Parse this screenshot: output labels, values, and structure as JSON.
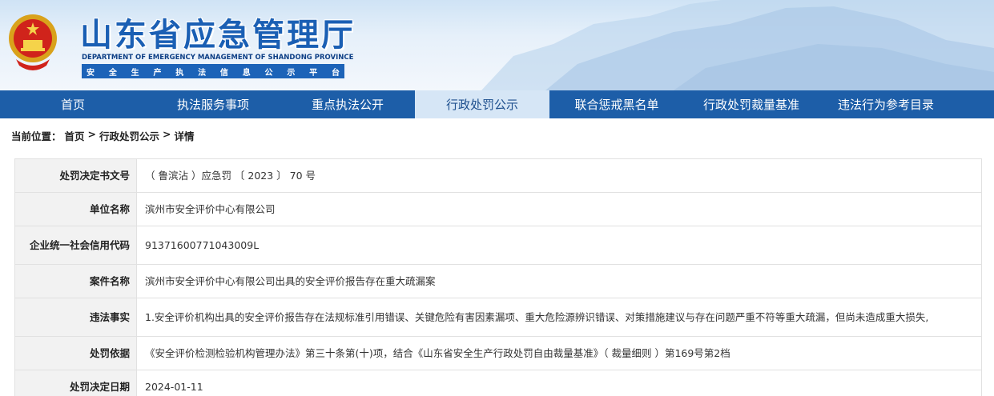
{
  "header": {
    "title": "山东省应急管理厅",
    "subtitle_en": "DEPARTMENT OF EMERGENCY MANAGEMENT OF SHANDONG PROVINCE",
    "subtitle_cn_chars": [
      "安",
      "全",
      "生",
      "产",
      "执",
      "法",
      "信",
      "息",
      "公",
      "示",
      "平",
      "台"
    ]
  },
  "nav": {
    "items": [
      {
        "label": "首页"
      },
      {
        "label": "执法服务事项"
      },
      {
        "label": "重点执法公开"
      },
      {
        "label": "行政处罚公示"
      },
      {
        "label": "联合惩戒黑名单"
      },
      {
        "label": "行政处罚裁量基准"
      },
      {
        "label": "违法行为参考目录"
      }
    ],
    "active_index": 3
  },
  "breadcrumb": {
    "prefix": "当前位置：",
    "home": "首页",
    "sep1": ">",
    "section": "行政处罚公示",
    "sep2": ">",
    "current": "详情"
  },
  "detail": {
    "rows": [
      {
        "label": "处罚决定书文号",
        "value": "（ 鲁滨沾 ）应急罚 〔 2023 〕 70 号"
      },
      {
        "label": "单位名称",
        "value": "滨州市安全评价中心有限公司"
      },
      {
        "label": "企业统一社会信用代码",
        "value": "91371600771043009L"
      },
      {
        "label": "案件名称",
        "value": "滨州市安全评价中心有限公司出具的安全评价报告存在重大疏漏案"
      },
      {
        "label": "违法事实",
        "value": "1.安全评价机构出具的安全评价报告存在法规标准引用错误、关键危险有害因素漏项、重大危险源辨识错误、对策措施建议与存在问题严重不符等重大疏漏，但尚未造成重大损失,"
      },
      {
        "label": "处罚依据",
        "value": "《安全评价检测检验机构管理办法》第三十条第(十)项，结合《山东省安全生产行政处罚自由裁量基准》（ 裁量细则 ）第169号第2档"
      },
      {
        "label": "处罚决定日期",
        "value": "2024-01-11"
      }
    ]
  },
  "colors": {
    "nav_bg": "#1d5ea8",
    "nav_active_bg": "#d6e6f6",
    "title_blue": "#1a5fb4",
    "label_bg": "#f2f2f2"
  }
}
